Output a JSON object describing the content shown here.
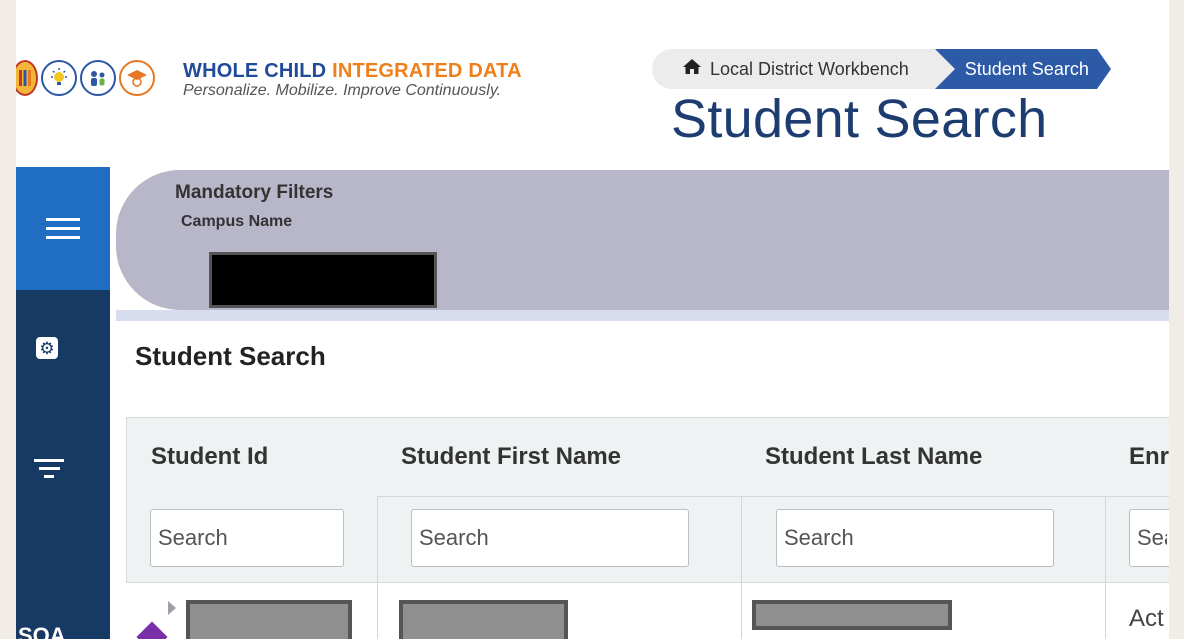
{
  "header": {
    "logo": {
      "title_part1": "WHOLE CHILD ",
      "title_part2": "INTEGRATED DATA",
      "tagline": "Personalize. Mobilize. Improve Continuously."
    },
    "breadcrumb": {
      "home_label": "Local District Workbench",
      "current_label": "Student Search"
    },
    "page_title": "Student Search"
  },
  "sidebar": {
    "icons": [
      "menu-icon",
      "gear-icon",
      "filter-icon"
    ],
    "bottom_label": "SOA"
  },
  "filters": {
    "title": "Mandatory Filters",
    "campus_label": "Campus Name"
  },
  "main": {
    "section_title": "Student Search",
    "columns": [
      {
        "header": "Student Id",
        "search_placeholder": "Search"
      },
      {
        "header": "Student First Name",
        "search_placeholder": "Search"
      },
      {
        "header": "Student Last Name",
        "search_placeholder": "Search"
      },
      {
        "header": "Enr",
        "search_placeholder": "Sea"
      }
    ],
    "rows": [
      {
        "enrollment": "Act"
      }
    ]
  },
  "colors": {
    "brand_blue": "#224a9a",
    "brand_orange": "#ef7f1a",
    "sidebar_dark": "#163a63",
    "sidebar_active": "#1f6ec4",
    "breadcrumb_active": "#2c5aa6",
    "filter_band": "#b7b7c9"
  }
}
